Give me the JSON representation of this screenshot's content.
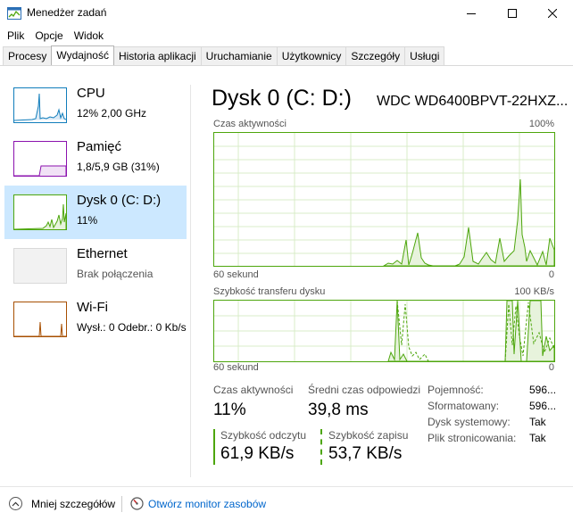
{
  "window": {
    "title": "Menedżer zadań"
  },
  "menu": [
    "Plik",
    "Opcje",
    "Widok"
  ],
  "tabs": [
    "Procesy",
    "Wydajność",
    "Historia aplikacji",
    "Uruchamianie",
    "Użytkownicy",
    "Szczegóły",
    "Usługi"
  ],
  "active_tab": "Wydajność",
  "resources": [
    {
      "name": "CPU",
      "sub": "12% 2,00 GHz",
      "color": "#117dbb"
    },
    {
      "name": "Pamięć",
      "sub": "1,8/5,9 GB (31%)",
      "color": "#8b12ae"
    },
    {
      "name": "Dysk 0 (C: D:)",
      "sub": "11%",
      "color": "#4da60c",
      "selected": true
    },
    {
      "name": "Ethernet",
      "sub": "Brak połączenia",
      "color": "#a74f01"
    },
    {
      "name": "Wi-Fi",
      "sub": "Wysł.: 0 Odebr.: 0 Kb/s",
      "color": "#a74f01"
    }
  ],
  "detail": {
    "title": "Dysk 0 (C: D:)",
    "model": "WDC WD6400BPVT-22HXZ...",
    "chart1": {
      "label": "Czas aktywności",
      "max": "100%",
      "time": "60 sekund",
      "min": "0"
    },
    "chart2": {
      "label": "Szybkość transferu dysku",
      "max": "100 KB/s",
      "time": "60 sekund",
      "min": "0"
    },
    "stats": {
      "active_label": "Czas aktywności",
      "active_value": "11%",
      "response_label": "Średni czas odpowiedzi",
      "response_value": "39,8 ms",
      "read_label": "Szybkość odczytu",
      "read_value": "61,9 KB/s",
      "write_label": "Szybkość zapisu",
      "write_value": "53,7 KB/s"
    },
    "meta": [
      {
        "label": "Pojemność:",
        "value": "596..."
      },
      {
        "label": "Sformatowany:",
        "value": "596..."
      },
      {
        "label": "Dysk systemowy:",
        "value": "Tak"
      },
      {
        "label": "Plik stronicowania:",
        "value": "Tak"
      }
    ]
  },
  "footer": {
    "less_details": "Mniej szczegółów",
    "open_monitor": "Otwórz monitor zasobów"
  },
  "colors": {
    "disk_green": "#4da60c",
    "selected_bg": "#cce8ff",
    "link_blue": "#0066cc"
  }
}
